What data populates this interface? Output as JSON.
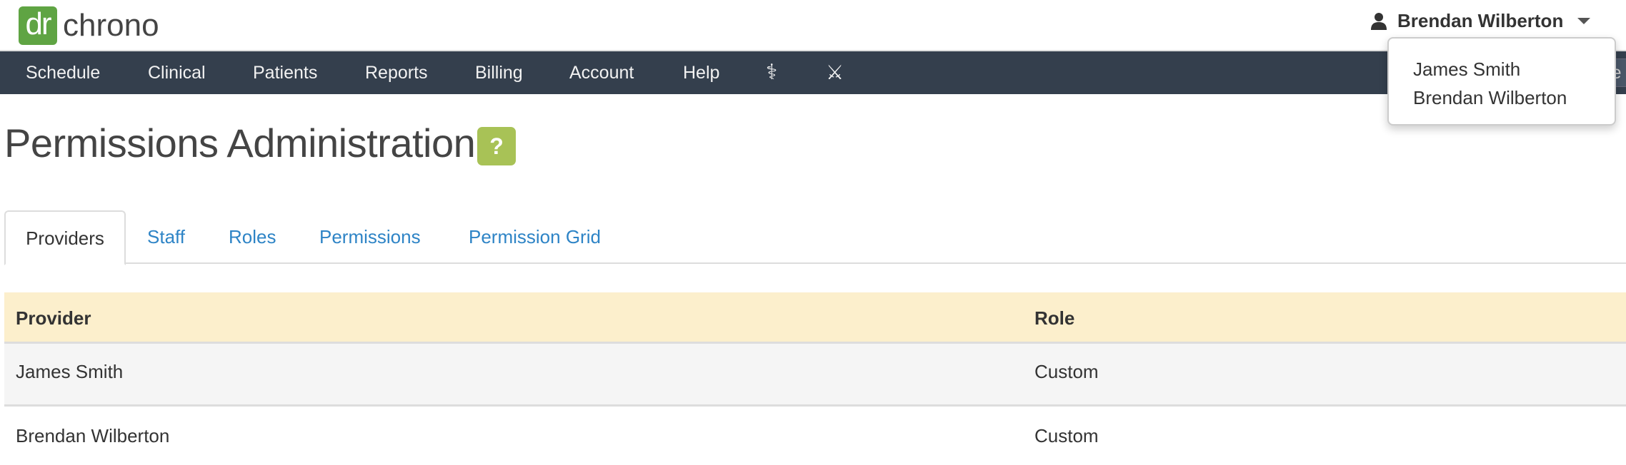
{
  "brand": {
    "logo_mark": "dr",
    "logo_text": "chrono",
    "color": "#5fa443"
  },
  "user_menu": {
    "name": "Brendan Wilberton",
    "icon": "user-icon",
    "options": [
      "James Smith",
      "Brendan Wilberton"
    ]
  },
  "nav": {
    "items": [
      "Schedule",
      "Clinical",
      "Patients",
      "Reports",
      "Billing",
      "Account",
      "Help"
    ],
    "icons": [
      "caduceus-icon",
      "crossed-swords-icon"
    ],
    "search_partial": "Se",
    "background": "#343f4d"
  },
  "page": {
    "title": "Permissions Administration",
    "help_label": "?",
    "help_color": "#a8c256"
  },
  "tabs": [
    {
      "label": "Providers",
      "active": true
    },
    {
      "label": "Staff"
    },
    {
      "label": "Roles"
    },
    {
      "label": "Permissions"
    },
    {
      "label": "Permission Grid"
    }
  ],
  "table": {
    "columns": [
      "Provider",
      "Role"
    ],
    "rows": [
      [
        "James Smith",
        "Custom"
      ],
      [
        "Brendan Wilberton",
        "Custom"
      ]
    ],
    "header_color": "#fcefcc"
  }
}
